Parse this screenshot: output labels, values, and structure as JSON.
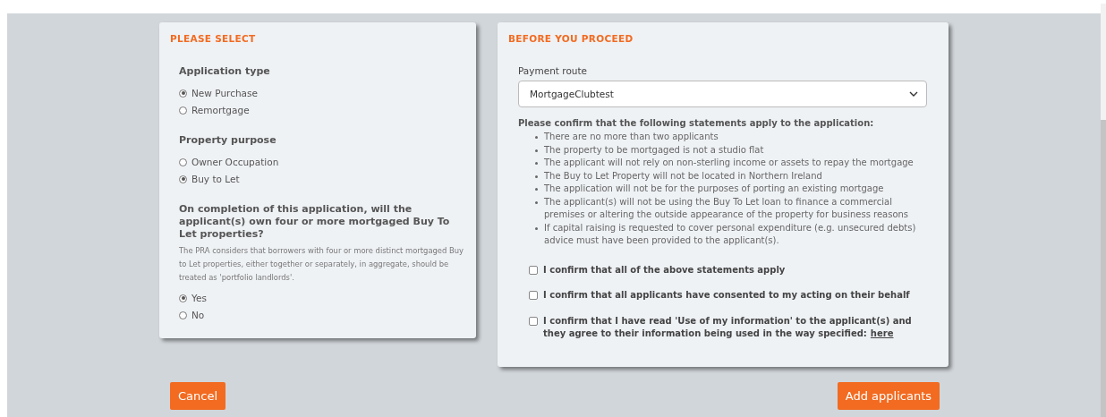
{
  "left_panel": {
    "title": "PLEASE SELECT",
    "groups": [
      {
        "label": "Application type",
        "options": [
          {
            "label": "New Purchase",
            "selected": true
          },
          {
            "label": "Remortgage",
            "selected": false
          }
        ]
      },
      {
        "label": "Property purpose",
        "options": [
          {
            "label": "Owner Occupation",
            "selected": false
          },
          {
            "label": "Buy to Let",
            "selected": true
          }
        ]
      },
      {
        "label": "On completion of this application, will the applicant(s) own four or more mortgaged Buy To Let properties?",
        "note": "The PRA considers that borrowers with four or more distinct mortgaged Buy to Let properties, either together or separately, in aggregate, should be treated as 'portfolio landlords'.",
        "options": [
          {
            "label": "Yes",
            "selected": true
          },
          {
            "label": "No",
            "selected": false
          }
        ]
      }
    ]
  },
  "right_panel": {
    "title": "BEFORE YOU PROCEED",
    "payment_route": {
      "label": "Payment route",
      "value": "MortgageClubtest"
    },
    "intro": "Please confirm that the following statements apply to the application:",
    "statements": [
      "There are no more than two applicants",
      "The property to be mortgaged is not a studio flat",
      "The applicant will not rely on non-sterling income or assets to repay the mortgage",
      "The Buy to Let Property will not be located in Northern Ireland",
      "The application will not be for the purposes of porting an existing mortgage",
      "The applicant(s) will not be using the Buy To Let loan to finance a commercial premises or altering the outside appearance of the property for business reasons",
      "If capital raising is requested to cover personal expenditure (e.g. unsecured debts) advice must have been provided to the applicant(s)."
    ],
    "confirmations": [
      {
        "text": "I confirm that all of the above statements apply",
        "checked": false
      },
      {
        "text": "I confirm that all applicants have consented to my acting on their behalf",
        "checked": false
      },
      {
        "text": "I confirm that I have read 'Use of my information' to the applicant(s) and they agree to their information being used in the way specified:",
        "link": "here",
        "checked": false
      }
    ]
  },
  "buttons": {
    "cancel": "Cancel",
    "proceed": "Add applicants"
  }
}
